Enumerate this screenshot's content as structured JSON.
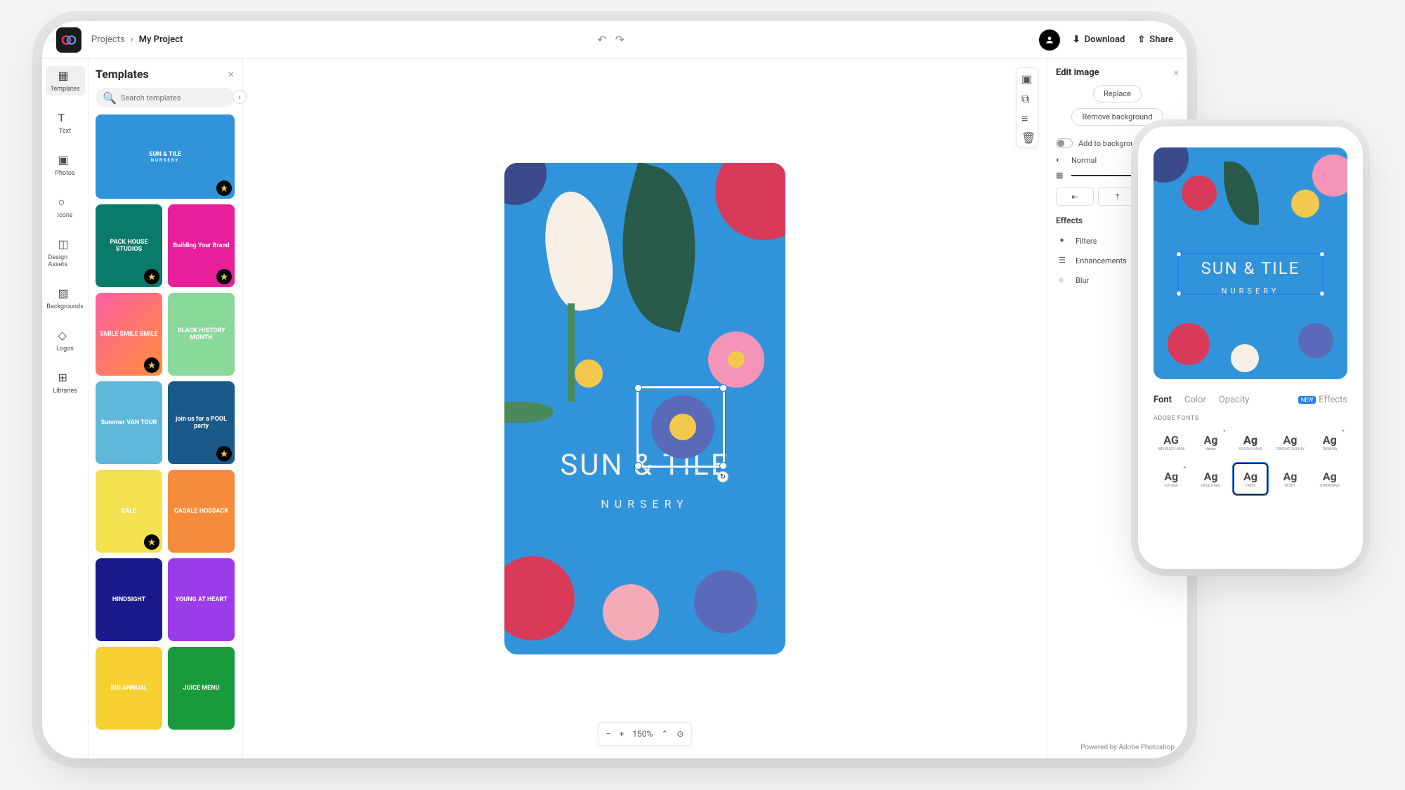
{
  "breadcrumb": {
    "root": "Projects",
    "current": "My Project"
  },
  "topbar": {
    "download": "Download",
    "share": "Share"
  },
  "rail": [
    {
      "name": "templates",
      "label": "Templates",
      "active": true
    },
    {
      "name": "text",
      "label": "Text"
    },
    {
      "name": "photos",
      "label": "Photos"
    },
    {
      "name": "icons",
      "label": "Icons"
    },
    {
      "name": "design-assets",
      "label": "Design Assets"
    },
    {
      "name": "backgrounds",
      "label": "Backgrounds"
    },
    {
      "name": "logos",
      "label": "Logos"
    },
    {
      "name": "libraries",
      "label": "Libraries"
    }
  ],
  "templates_panel": {
    "title": "Templates",
    "search_placeholder": "Search templates"
  },
  "templates": [
    {
      "title": "SUN & TILE",
      "subtitle": "NURSERY",
      "bg": "#3194db",
      "wide": true,
      "premium": true
    },
    {
      "title": "PACK HOUSE STUDIOS",
      "bg": "#0a7a6a",
      "premium": true
    },
    {
      "title": "Building Your Brand",
      "bg": "#e81f9a",
      "premium": true
    },
    {
      "title": "SMILE SMILE SMILE",
      "bg": "linear-gradient(135deg,#ff5fa2,#ff8e3c)",
      "premium": true
    },
    {
      "title": "BLACK HISTORY MONTH",
      "bg": "#89d99a"
    },
    {
      "title": "Summer VAN TOUR",
      "bg": "#5fb8d9"
    },
    {
      "title": "join us for a POOL party",
      "bg": "#1a5a8a",
      "premium": true
    },
    {
      "title": "SALE",
      "bg": "#f5e050",
      "premium": true
    },
    {
      "title": "CASALE HOSSACK",
      "bg": "#f58b3c"
    },
    {
      "title": "HINDSIGHT",
      "bg": "#1a1a8a"
    },
    {
      "title": "YOUNG AT HEART",
      "bg": "#9b3ce8"
    },
    {
      "title": "BIG ANNUAL",
      "bg": "#f5d030"
    },
    {
      "title": "JUICE MENU",
      "bg": "#1a9a3c"
    }
  ],
  "canvas": {
    "title": "SUN & TILE",
    "subtitle": "NURSERY",
    "zoom": "150%",
    "bg": "#3194db"
  },
  "edit_panel": {
    "title": "Edit image",
    "replace": "Replace",
    "remove_bg": "Remove background",
    "add_bg": "Add to background",
    "blend": "Normal",
    "effects_label": "Effects",
    "filters": "Filters",
    "enhancements": "Enhancements",
    "blur": "Blur"
  },
  "footer": "Powered by Adobe Photoshop",
  "phone": {
    "tabs": [
      "Font",
      "Color",
      "Opacity",
      "Effects"
    ],
    "fonts_section": "ADOBE FONTS",
    "fonts": [
      {
        "sample": "AG",
        "name": "OBVIOUSLY WIDE"
      },
      {
        "sample": "Ag",
        "name": "Kepler",
        "premium": true
      },
      {
        "sample": "Ag",
        "name": "NOODLE SANS",
        "bold": true
      },
      {
        "sample": "Ag",
        "name": "FREIGHT DISPLAY"
      },
      {
        "sample": "Ag",
        "name": "TERMINA",
        "premium": true
      },
      {
        "sample": "Ag",
        "name": "FUTURA",
        "premium": true
      },
      {
        "sample": "Ag",
        "name": "NEUE HAAS"
      },
      {
        "sample": "Ag",
        "name": "TIMES",
        "selected": true
      },
      {
        "sample": "Ag",
        "name": "RESET"
      },
      {
        "sample": "Ag",
        "name": "SUPERWAVE"
      }
    ]
  }
}
